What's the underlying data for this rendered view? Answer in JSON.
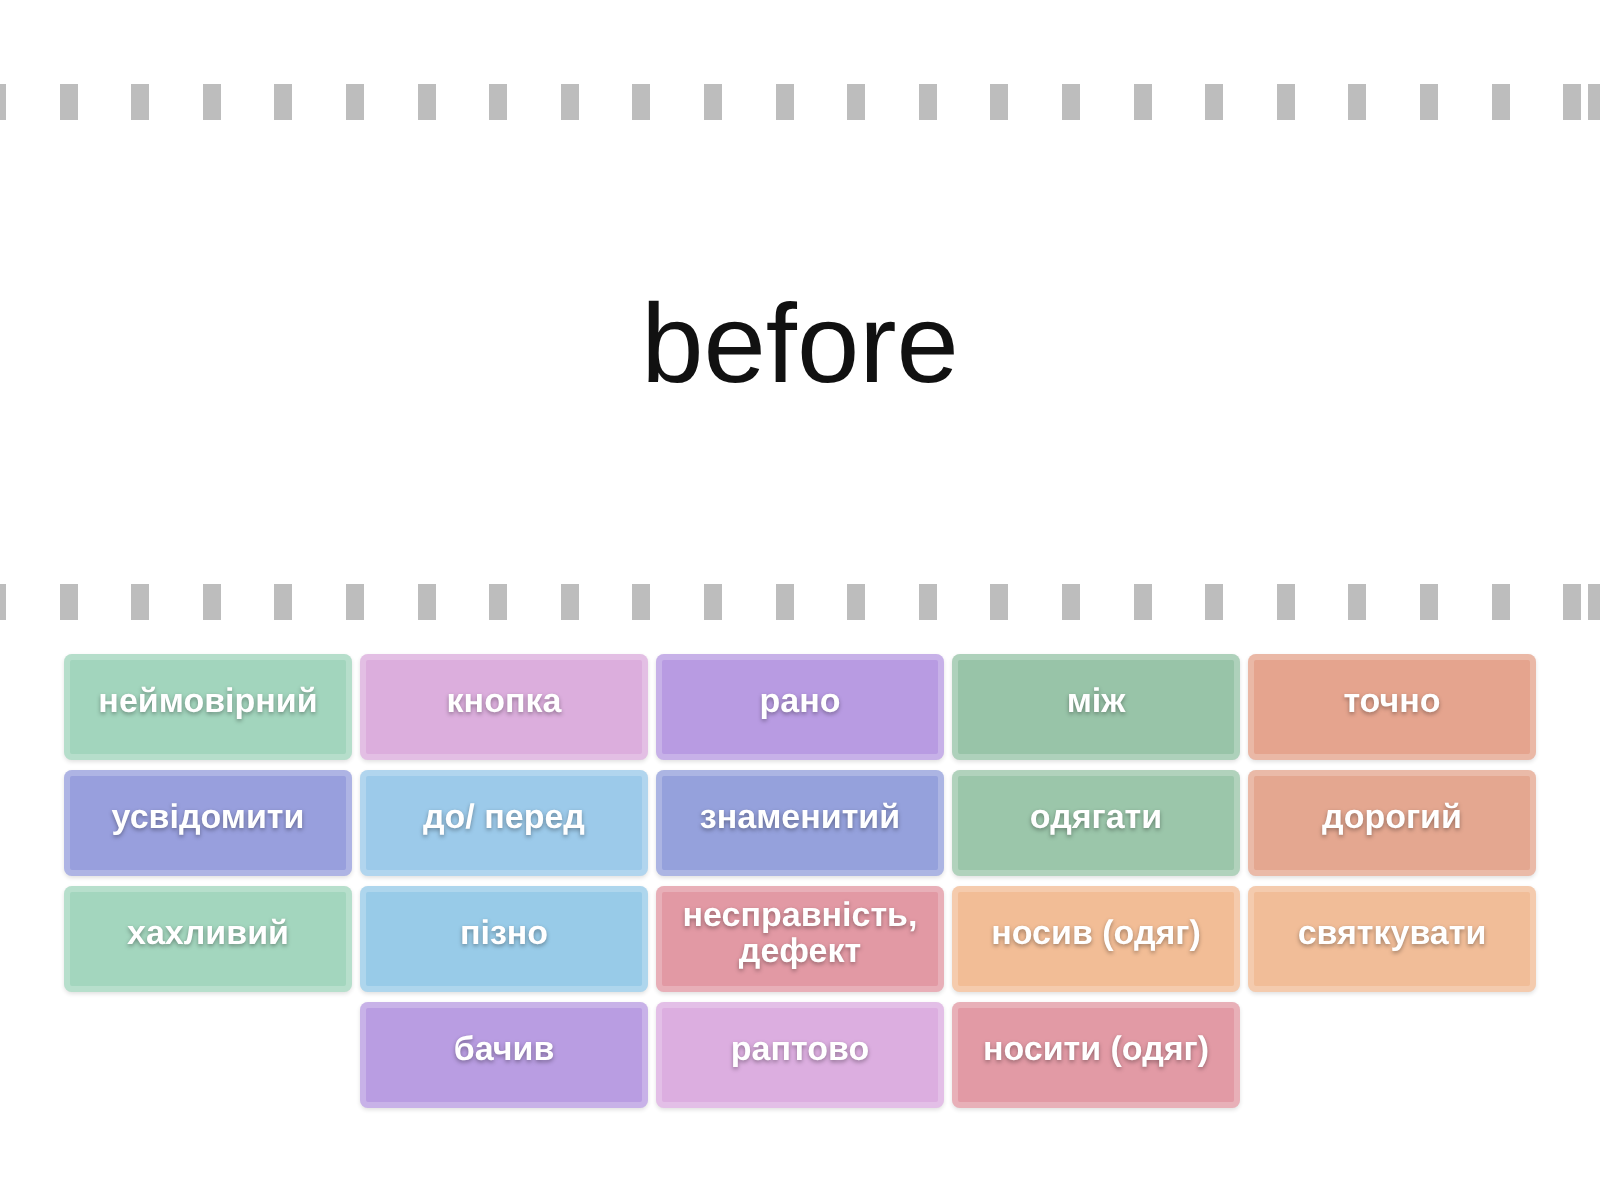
{
  "target_word": "before",
  "columns": [
    {
      "tiles": [
        {
          "text": "неймовірний",
          "color": "#a2d5bd"
        },
        {
          "text": "усвідомити",
          "color": "#989fdd"
        },
        {
          "text": "хахливий",
          "color": "#a3d6be"
        }
      ]
    },
    {
      "tiles": [
        {
          "text": "кнопка",
          "color": "#dcaedd"
        },
        {
          "text": "до/ перед",
          "color": "#9ccaea"
        },
        {
          "text": "пізно",
          "color": "#98cbe8"
        },
        {
          "text": "бачив",
          "color": "#b99de2"
        }
      ]
    },
    {
      "tiles": [
        {
          "text": "рано",
          "color": "#b89be2"
        },
        {
          "text": "знаменитий",
          "color": "#95a1dc"
        },
        {
          "text": "несправність, дефект",
          "color": "#e299a4"
        },
        {
          "text": "раптово",
          "color": "#dcaee0"
        }
      ]
    },
    {
      "tiles": [
        {
          "text": "між",
          "color": "#98c4a8"
        },
        {
          "text": "одягати",
          "color": "#9bc6aa"
        },
        {
          "text": "носив (одяг)",
          "color": "#f2bd96"
        },
        {
          "text": "носити (одяг)",
          "color": "#e29aa5"
        }
      ]
    },
    {
      "tiles": [
        {
          "text": "точно",
          "color": "#e5a48e"
        },
        {
          "text": "дорогий",
          "color": "#e4a790"
        },
        {
          "text": "святкувати",
          "color": "#f1bd98"
        }
      ]
    }
  ]
}
